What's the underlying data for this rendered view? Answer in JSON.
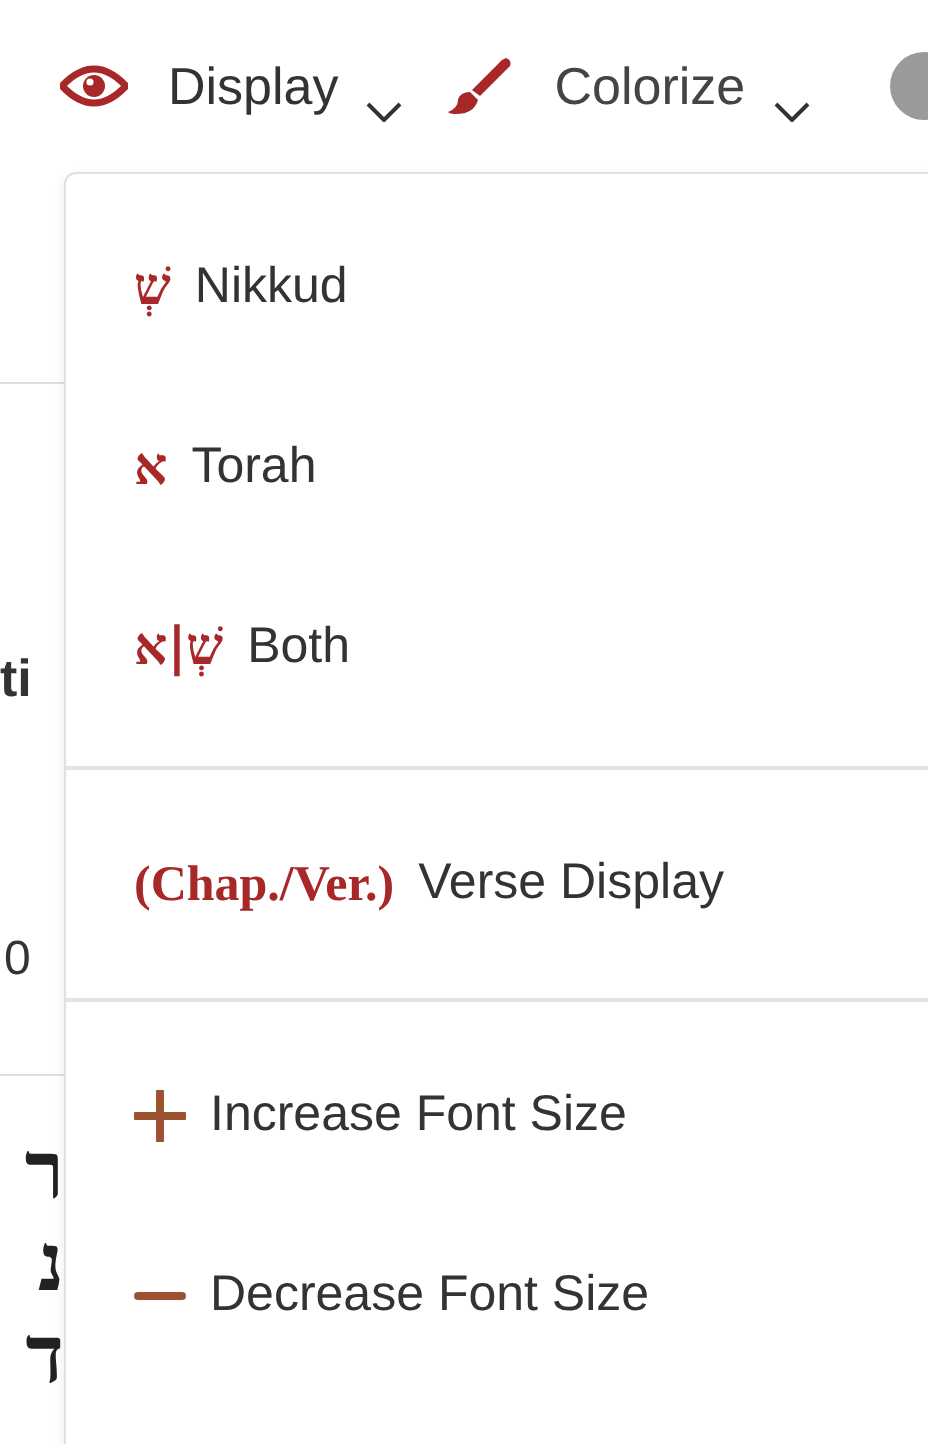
{
  "toolbar": {
    "menus": [
      {
        "label": "Display",
        "kind": "eye",
        "expanded": true
      },
      {
        "label": "Colorize",
        "kind": "brush",
        "expanded": false
      }
    ]
  },
  "background": {
    "fragments": [
      "ti",
      "0"
    ],
    "hebrew": [
      "ר",
      "נ",
      "ד"
    ]
  },
  "dropdown": {
    "groups": [
      {
        "items": [
          {
            "kind": "hebrew",
            "icon_text": "שְׁ",
            "label": "Nikkud"
          },
          {
            "kind": "hebrew",
            "icon_text": "א",
            "label": "Torah"
          },
          {
            "kind": "hebrew",
            "icon_text": "שְׁ|א",
            "label": "Both"
          }
        ]
      },
      {
        "items": [
          {
            "kind": "serif",
            "icon_text": "(Chap./Ver.)",
            "label": "Verse Display"
          }
        ]
      },
      {
        "items": [
          {
            "kind": "plus",
            "label": "Increase Font Size"
          },
          {
            "kind": "minus",
            "label": "Decrease Font Size"
          }
        ]
      }
    ]
  }
}
